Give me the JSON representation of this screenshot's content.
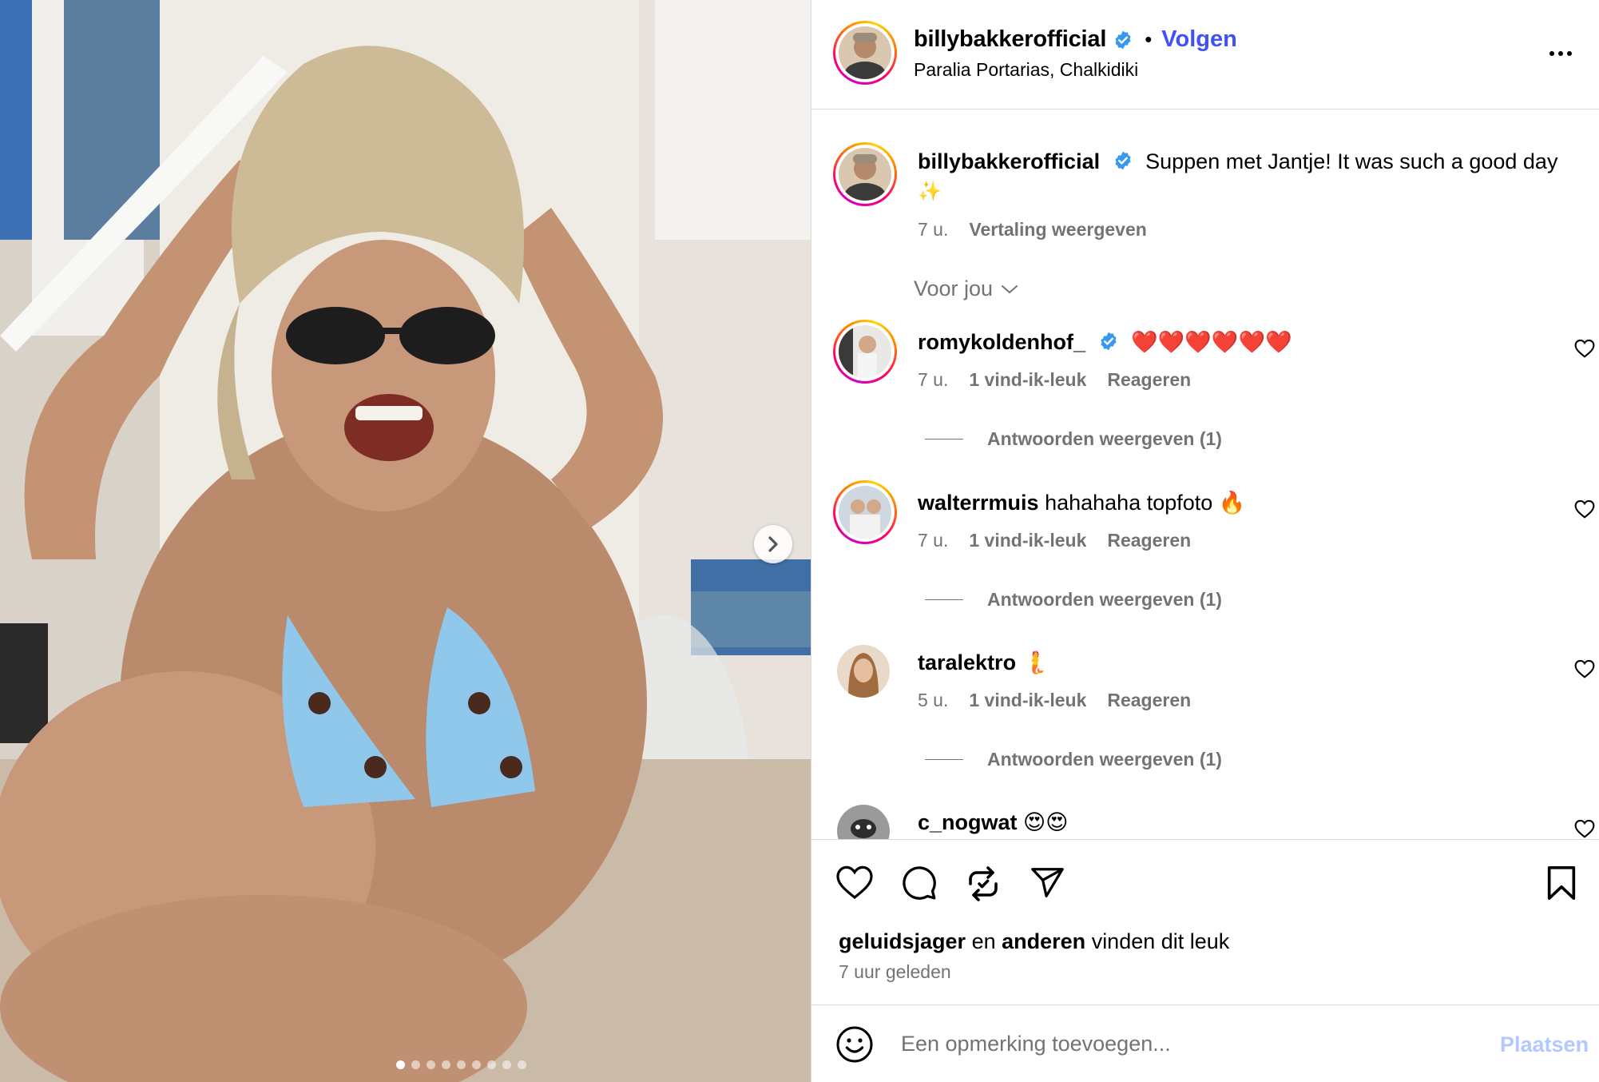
{
  "post": {
    "author": "billybakkerofficial",
    "follow_label": "Volgen",
    "separator": "•",
    "location": "Paralia Portarias, Chalkidiki",
    "media": {
      "carousel_count": 9,
      "active_index": 0
    }
  },
  "caption": {
    "username": "billybakkerofficial",
    "text": "Suppen met Jantje! It was such a good day",
    "emoji": "✨",
    "time": "7 u.",
    "translate_label": "Vertaling weergeven"
  },
  "sort_label": "Voor jou",
  "comments": [
    {
      "username": "romykoldenhof_",
      "verified": true,
      "text": "❤️❤️❤️❤️❤️❤️",
      "time": "7 u.",
      "likes": "1 vind-ik-leuk",
      "reply_label": "Reageren",
      "view_replies": "Antwoorden weergeven (1)"
    },
    {
      "username": "walterrmuis",
      "verified": false,
      "text": "hahahaha topfoto 🔥",
      "time": "7 u.",
      "likes": "1 vind-ik-leuk",
      "reply_label": "Reageren",
      "view_replies": "Antwoorden weergeven (1)"
    },
    {
      "username": "taralektro",
      "verified": false,
      "text": "🧜",
      "time": "5 u.",
      "likes": "1 vind-ik-leuk",
      "reply_label": "Reageren",
      "view_replies": "Antwoorden weergeven (1)"
    },
    {
      "username": "c_nogwat",
      "verified": false,
      "text": "😍😍"
    }
  ],
  "likes_summary": {
    "first_liker": "geluidsjager",
    "connector": "en",
    "others": "anderen",
    "suffix": "vinden dit leuk",
    "time_ago": "7 uur geleden"
  },
  "add_comment": {
    "placeholder": "Een opmerking toevoegen...",
    "post_label": "Plaatsen"
  },
  "colors": {
    "follow": "#4150f7",
    "verified": "#3897f0",
    "muted": "#737373",
    "post_disabled": "#b2c8ff"
  }
}
